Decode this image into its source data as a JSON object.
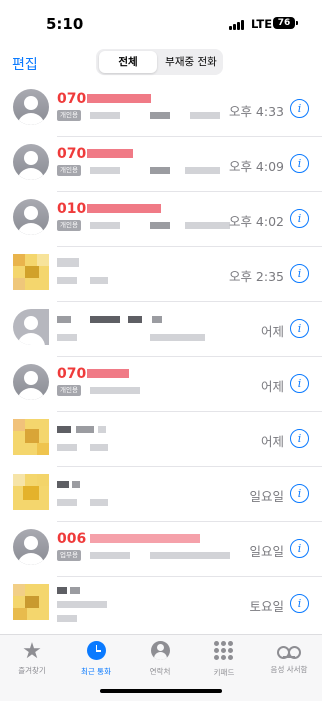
{
  "status_bar": {
    "time": "5:10",
    "network": "LTE",
    "battery": "76"
  },
  "nav": {
    "edit_label": "편집",
    "tabs": [
      "전체",
      "부재중 전화"
    ]
  },
  "calls": [
    {
      "number": "070",
      "badge": "개인용",
      "time": "오후 4:33",
      "avatar": "person"
    },
    {
      "number": "070",
      "badge": "개인용",
      "time": "오후 4:09",
      "avatar": "person"
    },
    {
      "number": "010",
      "badge": "개인용",
      "time": "오후 4:02",
      "avatar": "person"
    },
    {
      "number": "",
      "badge": "",
      "time": "오후 2:35",
      "avatar": "photo"
    },
    {
      "number": "",
      "badge": "",
      "time": "어제",
      "avatar": "photo-gray"
    },
    {
      "number": "070",
      "badge": "개인용",
      "time": "어제",
      "avatar": "person"
    },
    {
      "number": "",
      "badge": "",
      "time": "어제",
      "avatar": "photo"
    },
    {
      "number": "",
      "badge": "",
      "time": "일요일",
      "avatar": "photo"
    },
    {
      "number": "006",
      "badge": "업무용",
      "time": "일요일",
      "avatar": "person"
    },
    {
      "number": "",
      "badge": "",
      "time": "토요일",
      "avatar": "photo"
    }
  ],
  "tab_bar": {
    "items": [
      {
        "label": "즐겨찾기",
        "icon": "star-icon"
      },
      {
        "label": "최근 통화",
        "icon": "clock-icon",
        "active": true
      },
      {
        "label": "연락처",
        "icon": "person-icon"
      },
      {
        "label": "키패드",
        "icon": "keypad-icon"
      },
      {
        "label": "음성 사서함",
        "icon": "voicemail-icon"
      }
    ]
  },
  "colors": {
    "accent": "#0a7aff",
    "missed": "#ef3b3b"
  }
}
